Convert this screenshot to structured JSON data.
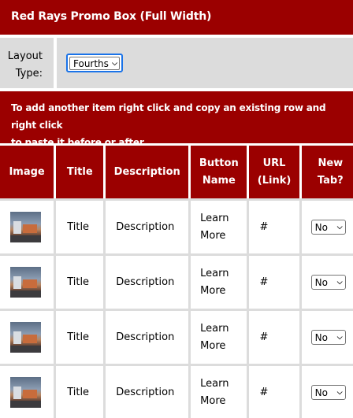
{
  "header": {
    "title": "Red Rays Promo Box (Full Width)"
  },
  "layout": {
    "label_line1": "Layout",
    "label_line2": "Type:",
    "selected": "Fourths"
  },
  "info": {
    "line1": "To add another item right click and copy an existing row and right click",
    "line2": "to paste it before or after."
  },
  "table": {
    "headers": {
      "image": "Image",
      "title": "Title",
      "description": "Description",
      "button_line1": "Button",
      "button_line2": "Name",
      "url_line1": "URL",
      "url_line2": "(Link)",
      "newtab_line1": "New",
      "newtab_line2": "Tab?"
    },
    "rows": [
      {
        "title": "Title",
        "description": "Description",
        "button_line1": "Learn",
        "button_line2": "More",
        "url": "#",
        "new_tab": "No"
      },
      {
        "title": "Title",
        "description": "Description",
        "button_line1": "Learn",
        "button_line2": "More",
        "url": "#",
        "new_tab": "No"
      },
      {
        "title": "Title",
        "description": "Description",
        "button_line1": "Learn",
        "button_line2": "More",
        "url": "#",
        "new_tab": "No"
      },
      {
        "title": "Title",
        "description": "Description",
        "button_line1": "Learn",
        "button_line2": "More",
        "url": "#",
        "new_tab": "No"
      }
    ]
  },
  "colors": {
    "header_bg": "#9b0000",
    "panel_bg": "#dcdcdc",
    "focus": "#1a73e8"
  },
  "icons": {
    "select_arrow": "chevron-down-icon",
    "thumbnail": "building-photo-thumbnail"
  }
}
